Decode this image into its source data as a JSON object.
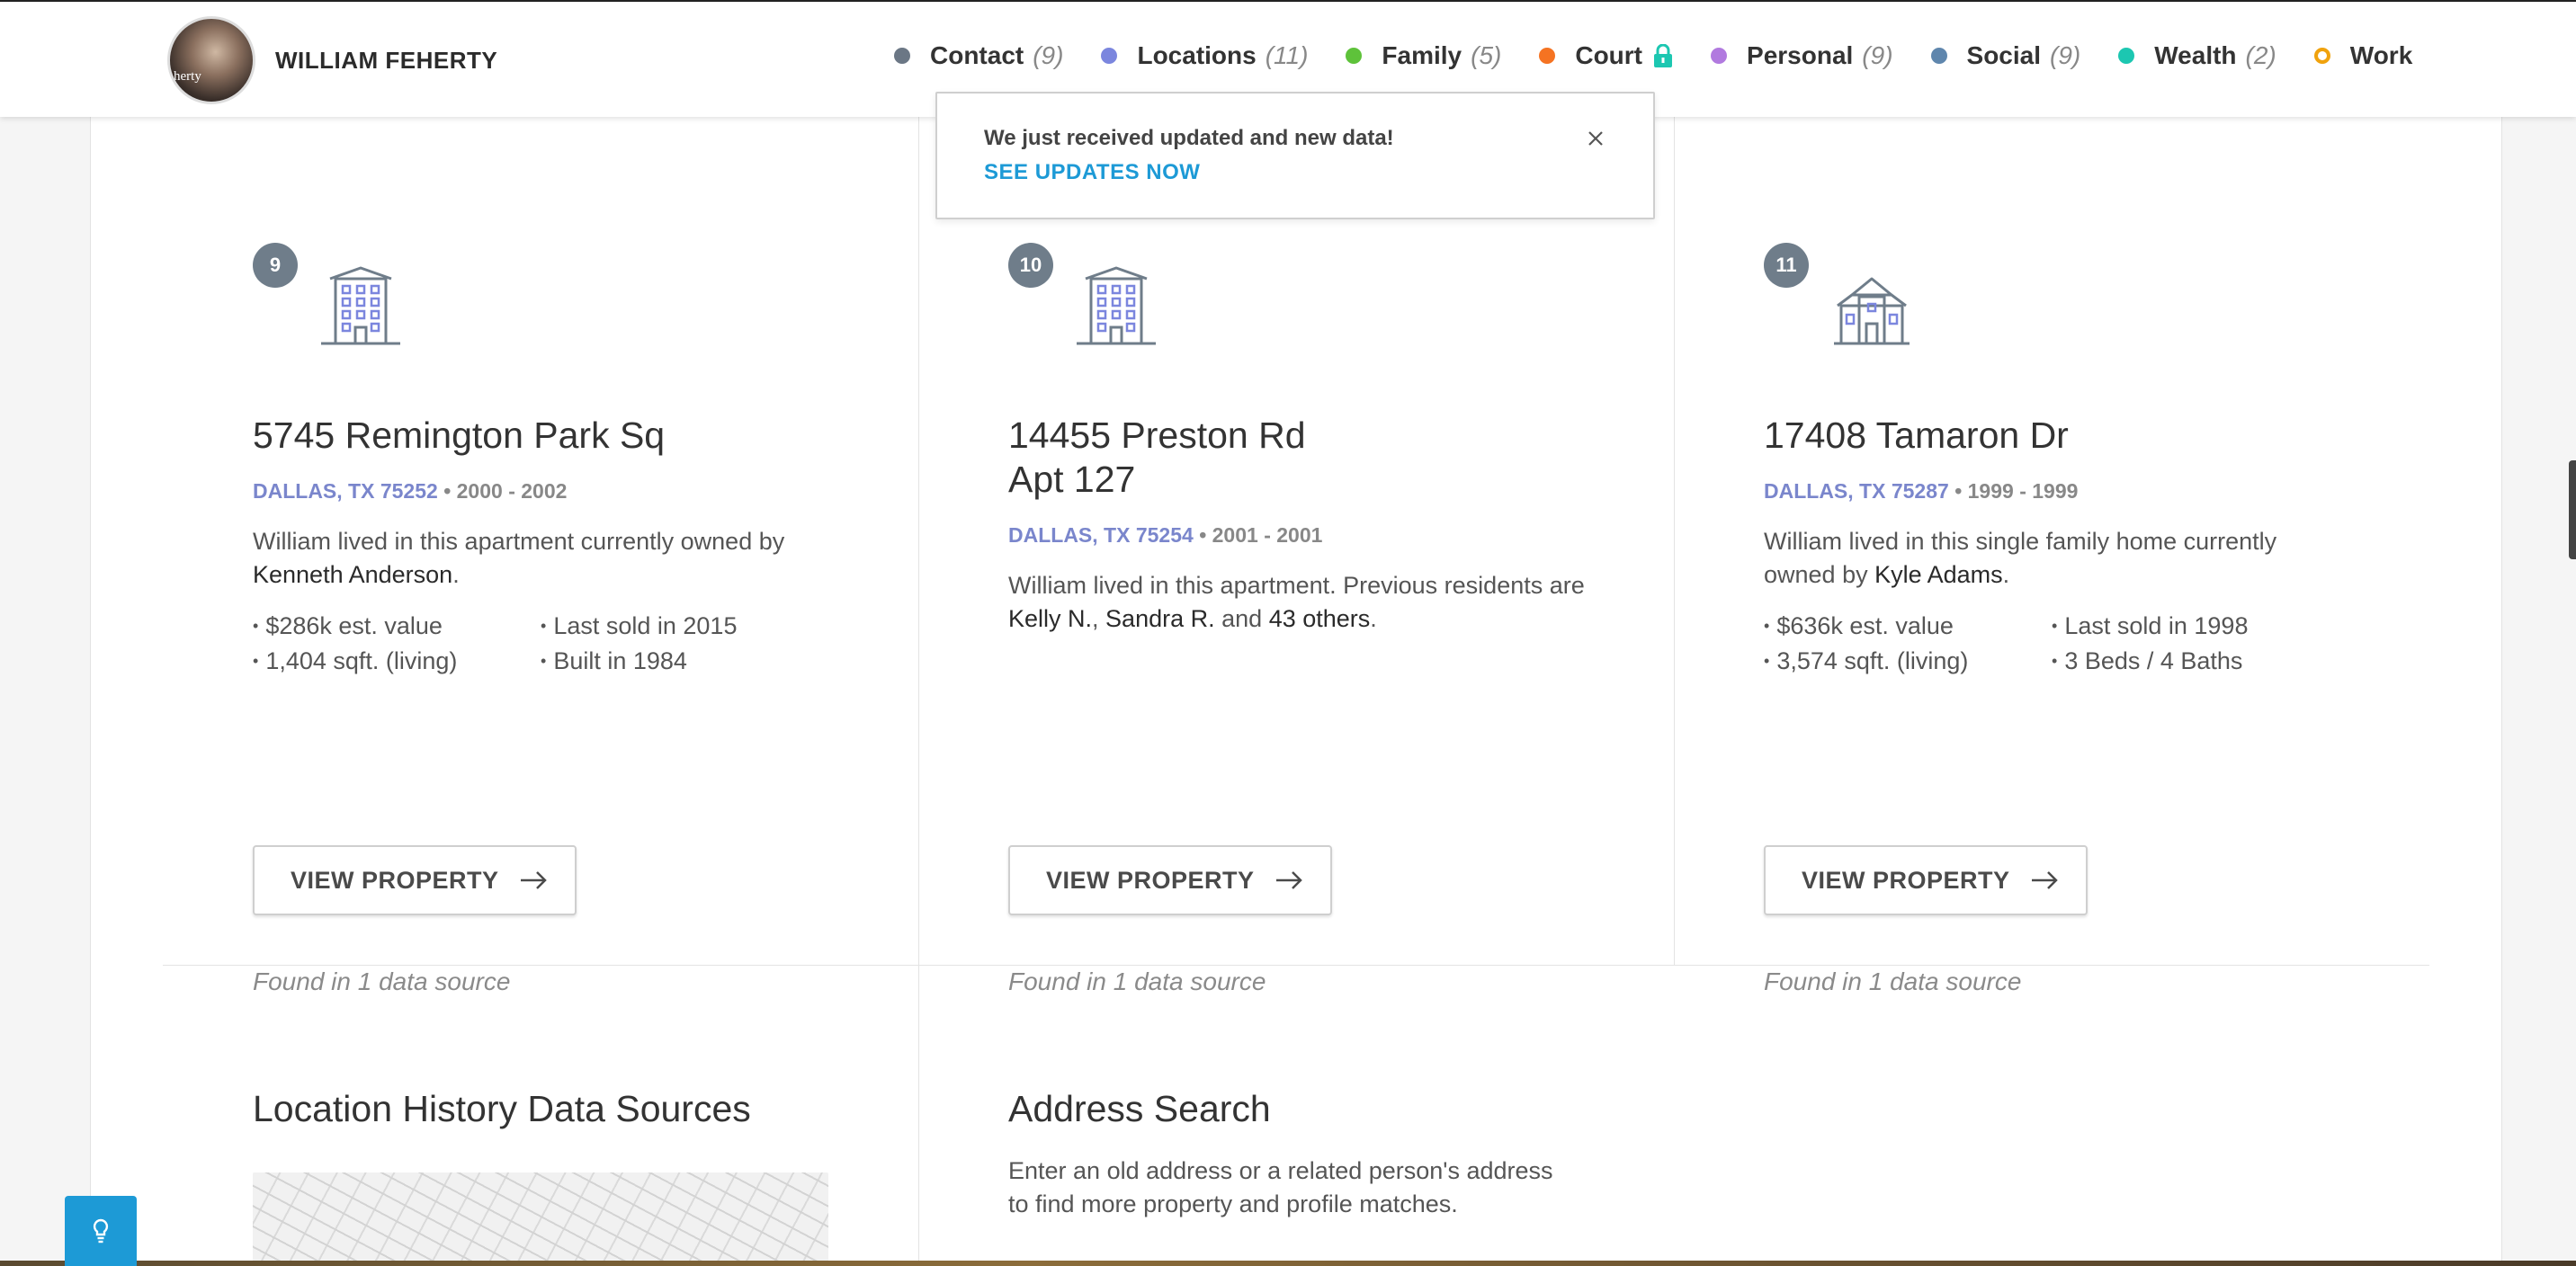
{
  "header": {
    "person_name": "WILLIAM FEHERTY",
    "avatar_text": "herty",
    "nav": [
      {
        "label": "Contact",
        "count": "(9)",
        "color": "#6b7785"
      },
      {
        "label": "Locations",
        "count": "(11)",
        "color": "#7b86de"
      },
      {
        "label": "Family",
        "count": "(5)",
        "color": "#5ec23a"
      },
      {
        "label": "Court",
        "count": "",
        "color": "#f57322",
        "locked": true
      },
      {
        "label": "Personal",
        "count": "(9)",
        "color": "#b17adf"
      },
      {
        "label": "Social",
        "count": "(9)",
        "color": "#5f86ad"
      },
      {
        "label": "Wealth",
        "count": "(2)",
        "color": "#1cc7b1"
      },
      {
        "label": "Work",
        "count": "",
        "color": "#f0a20d"
      }
    ]
  },
  "notification": {
    "message": "We just received updated and new data!",
    "link": "SEE UPDATES NOW"
  },
  "properties": [
    {
      "number": "9",
      "icon": "apartment-building-icon",
      "address_line1": "5745 Remington Park Sq",
      "address_line2": "",
      "city": "DALLAS, TX 75252",
      "years": "2000 - 2002",
      "desc_pre": "William lived in this apartment currently owned by ",
      "desc_name": "Kenneth Anderson",
      "desc_post": ".",
      "facts": [
        "$286k est. value",
        "Last sold in 2015",
        "1,404 sqft. (living)",
        "Built in 1984"
      ],
      "button": "VIEW PROPERTY",
      "found": "Found in 1 data source"
    },
    {
      "number": "10",
      "icon": "apartment-building-icon",
      "address_line1": "14455 Preston Rd",
      "address_line2": "Apt 127",
      "city": "DALLAS, TX 75254",
      "years": "2001 - 2001",
      "desc_pre": "William lived in this apartment. Previous residents are ",
      "residents": [
        "Kelly N.",
        "Sandra R."
      ],
      "others": "43 others",
      "button": "VIEW PROPERTY",
      "found": "Found in 1 data source"
    },
    {
      "number": "11",
      "icon": "house-icon",
      "address_line1": "17408 Tamaron Dr",
      "address_line2": "",
      "city": "DALLAS, TX 75287",
      "years": "1999 - 1999",
      "desc_pre": "William lived in this single family home currently owned by ",
      "desc_name": "Kyle Adams",
      "desc_post": ".",
      "facts": [
        "$636k est. value",
        "Last sold in 1998",
        "3,574 sqft. (living)",
        "3 Beds / 4 Baths"
      ],
      "button": "VIEW PROPERTY",
      "found": "Found in 1 data source"
    }
  ],
  "sections": {
    "history_title": "Location History Data Sources",
    "search_title": "Address Search",
    "search_desc": "Enter an old address or a related person's address to find more property and profile matches."
  },
  "icons": {
    "help": "lightbulb-icon",
    "close": "close-icon",
    "arrow": "arrow-right-icon",
    "lock": "lock-icon"
  }
}
